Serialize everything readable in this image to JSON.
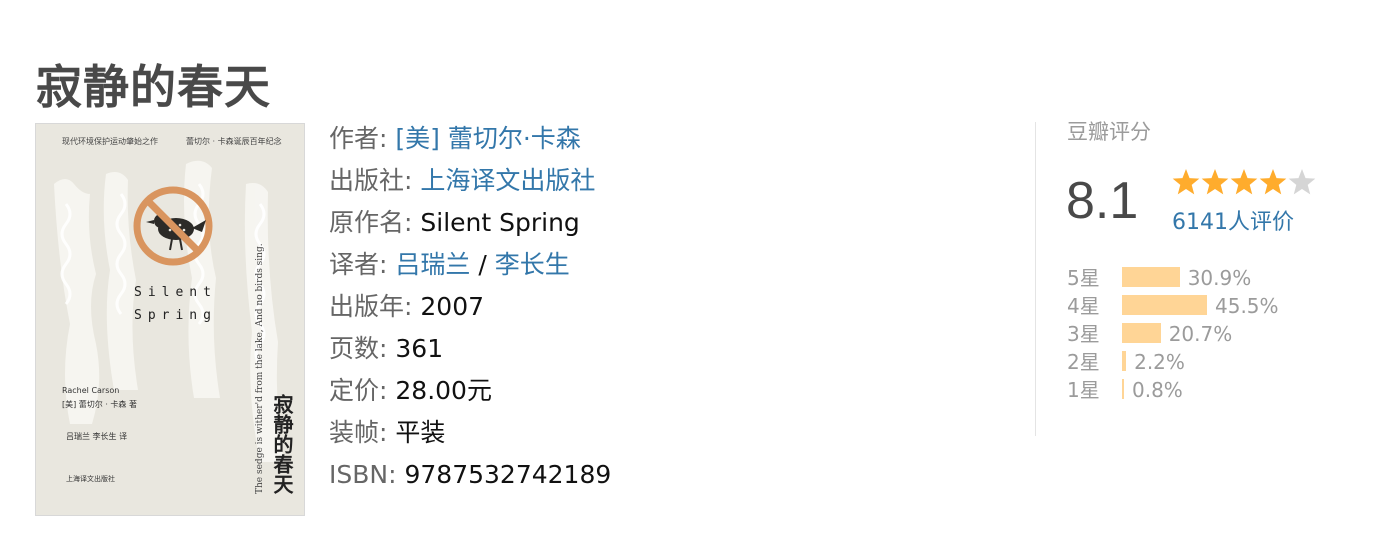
{
  "title": "寂静的春天",
  "cover": {
    "top_left": "现代环境保护运动肇始之作",
    "top_right": "蕾切尔 · 卡森诞辰百年纪念",
    "en_title_1": "Silent",
    "en_title_2": "Spring",
    "author_en": "Rachel Carson",
    "author_cn": "[美] 蕾切尔 · 卡森 著",
    "translators": "吕瑞兰    李长生 译",
    "publisher": "上海译文出版社",
    "cn_title": "寂静的春天",
    "quote": "The sedge is wither'd from the lake, And no birds sing.",
    "icon": "no-bird-icon"
  },
  "info": {
    "author_label": "作者:",
    "author_value": "[美] 蕾切尔·卡森",
    "publisher_label": "出版社:",
    "publisher_value": "上海译文出版社",
    "original_label": "原作名:",
    "original_value": "Silent Spring",
    "translator_label": "译者:",
    "translator_1": "吕瑞兰",
    "translator_sep": "/",
    "translator_2": "李长生",
    "year_label": "出版年:",
    "year_value": "2007",
    "pages_label": "页数:",
    "pages_value": "361",
    "price_label": "定价:",
    "price_value": "28.00元",
    "binding_label": "装帧:",
    "binding_value": "平装",
    "isbn_label": "ISBN:",
    "isbn_value": "9787532742189"
  },
  "rating": {
    "label": "豆瓣评分",
    "score": "8.1",
    "stars": 4,
    "star_max": 5,
    "votes": "6141人评价",
    "colors": {
      "star_on": "#ffac2d",
      "star_off": "#d5d5d5",
      "bar": "#ffd596",
      "link": "#3377aa"
    },
    "distribution": [
      {
        "label": "5星",
        "percent_text": "30.9%",
        "percent": 30.9
      },
      {
        "label": "4星",
        "percent_text": "45.5%",
        "percent": 45.5
      },
      {
        "label": "3星",
        "percent_text": "20.7%",
        "percent": 20.7
      },
      {
        "label": "2星",
        "percent_text": "2.2%",
        "percent": 2.2
      },
      {
        "label": "1星",
        "percent_text": "0.8%",
        "percent": 0.8
      }
    ]
  }
}
